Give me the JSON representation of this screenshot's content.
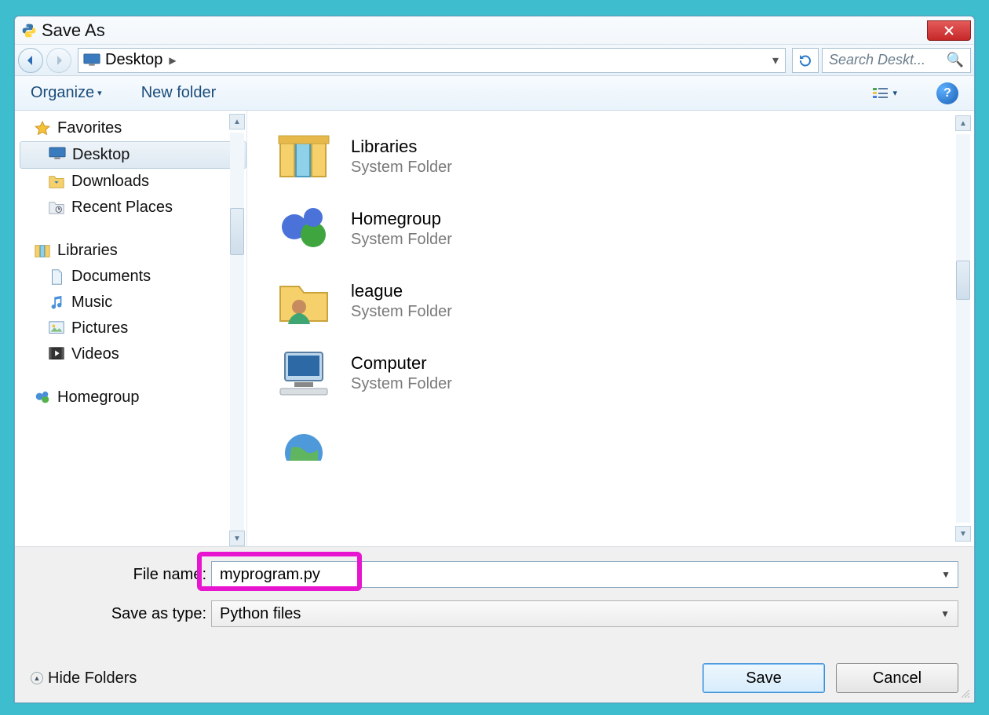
{
  "window": {
    "title": "Save As"
  },
  "nav": {
    "location": "Desktop",
    "search_placeholder": "Search Deskt..."
  },
  "toolbar": {
    "organize": "Organize",
    "new_folder": "New folder"
  },
  "sidebar": {
    "favorites_label": "Favorites",
    "favorites": [
      {
        "label": "Desktop",
        "selected": true
      },
      {
        "label": "Downloads"
      },
      {
        "label": "Recent Places"
      }
    ],
    "libraries_label": "Libraries",
    "libraries": [
      {
        "label": "Documents"
      },
      {
        "label": "Music"
      },
      {
        "label": "Pictures"
      },
      {
        "label": "Videos"
      }
    ],
    "homegroup_label": "Homegroup"
  },
  "main_items": [
    {
      "name": "Libraries",
      "type": "System Folder",
      "icon": "libraries"
    },
    {
      "name": "Homegroup",
      "type": "System Folder",
      "icon": "homegroup"
    },
    {
      "name": "league",
      "type": "System Folder",
      "icon": "user"
    },
    {
      "name": "Computer",
      "type": "System Folder",
      "icon": "computer"
    }
  ],
  "form": {
    "filename_label": "File name:",
    "filename_value": "myprogram.py",
    "type_label": "Save as type:",
    "type_value": "Python files",
    "hide_folders": "Hide Folders",
    "save": "Save",
    "cancel": "Cancel"
  }
}
